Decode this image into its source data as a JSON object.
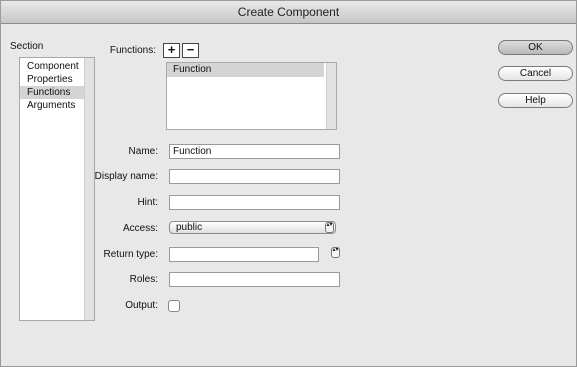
{
  "window": {
    "title": "Create Component"
  },
  "section": {
    "label": "Section",
    "items": [
      {
        "label": "Component"
      },
      {
        "label": "Properties"
      },
      {
        "label": "Functions",
        "selected": true
      },
      {
        "label": "Arguments"
      }
    ]
  },
  "functions": {
    "label": "Functions:",
    "add_symbol": "+",
    "remove_symbol": "−",
    "list": [
      "Function"
    ]
  },
  "form": {
    "name_label": "Name:",
    "name_value": "Function",
    "display_name_label": "Display name:",
    "display_name_value": "",
    "hint_label": "Hint:",
    "hint_value": "",
    "access_label": "Access:",
    "access_value": "public",
    "return_type_label": "Return type:",
    "return_type_value": "",
    "roles_label": "Roles:",
    "roles_value": "",
    "output_label": "Output:",
    "output_checked": false
  },
  "buttons": {
    "ok": "OK",
    "cancel": "Cancel",
    "help": "Help"
  },
  "stepper_glyph": "▴▾"
}
